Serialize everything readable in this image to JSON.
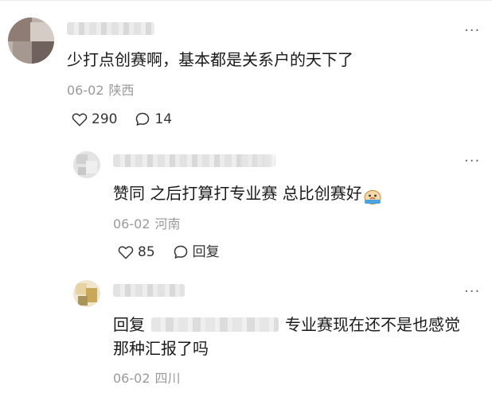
{
  "comments": [
    {
      "text": "少打点创赛啊，基本都是关系户的天下了",
      "date": "06-02",
      "location": "陕西",
      "likes": "290",
      "replies": "14",
      "more": "···"
    },
    {
      "text": "赞同 之后打算打专业赛 总比创赛好",
      "date": "06-02",
      "location": "河南",
      "likes": "85",
      "reply_label": "回复",
      "more": "···"
    },
    {
      "text_prefix": "回复",
      "text_suffix": "专业赛现在还不是也感觉",
      "text_line2": "那种汇报了吗",
      "date": "06-02",
      "location": "四川",
      "more": "···"
    }
  ],
  "colors": {
    "meta": "#9a9a9a",
    "text": "#1a1a1a",
    "icon": "#333333"
  },
  "icons": {
    "like": "heart-outline-icon",
    "comment": "speech-bubble-icon",
    "more": "more-dots-icon",
    "emoji": "cry-emoji-icon"
  }
}
